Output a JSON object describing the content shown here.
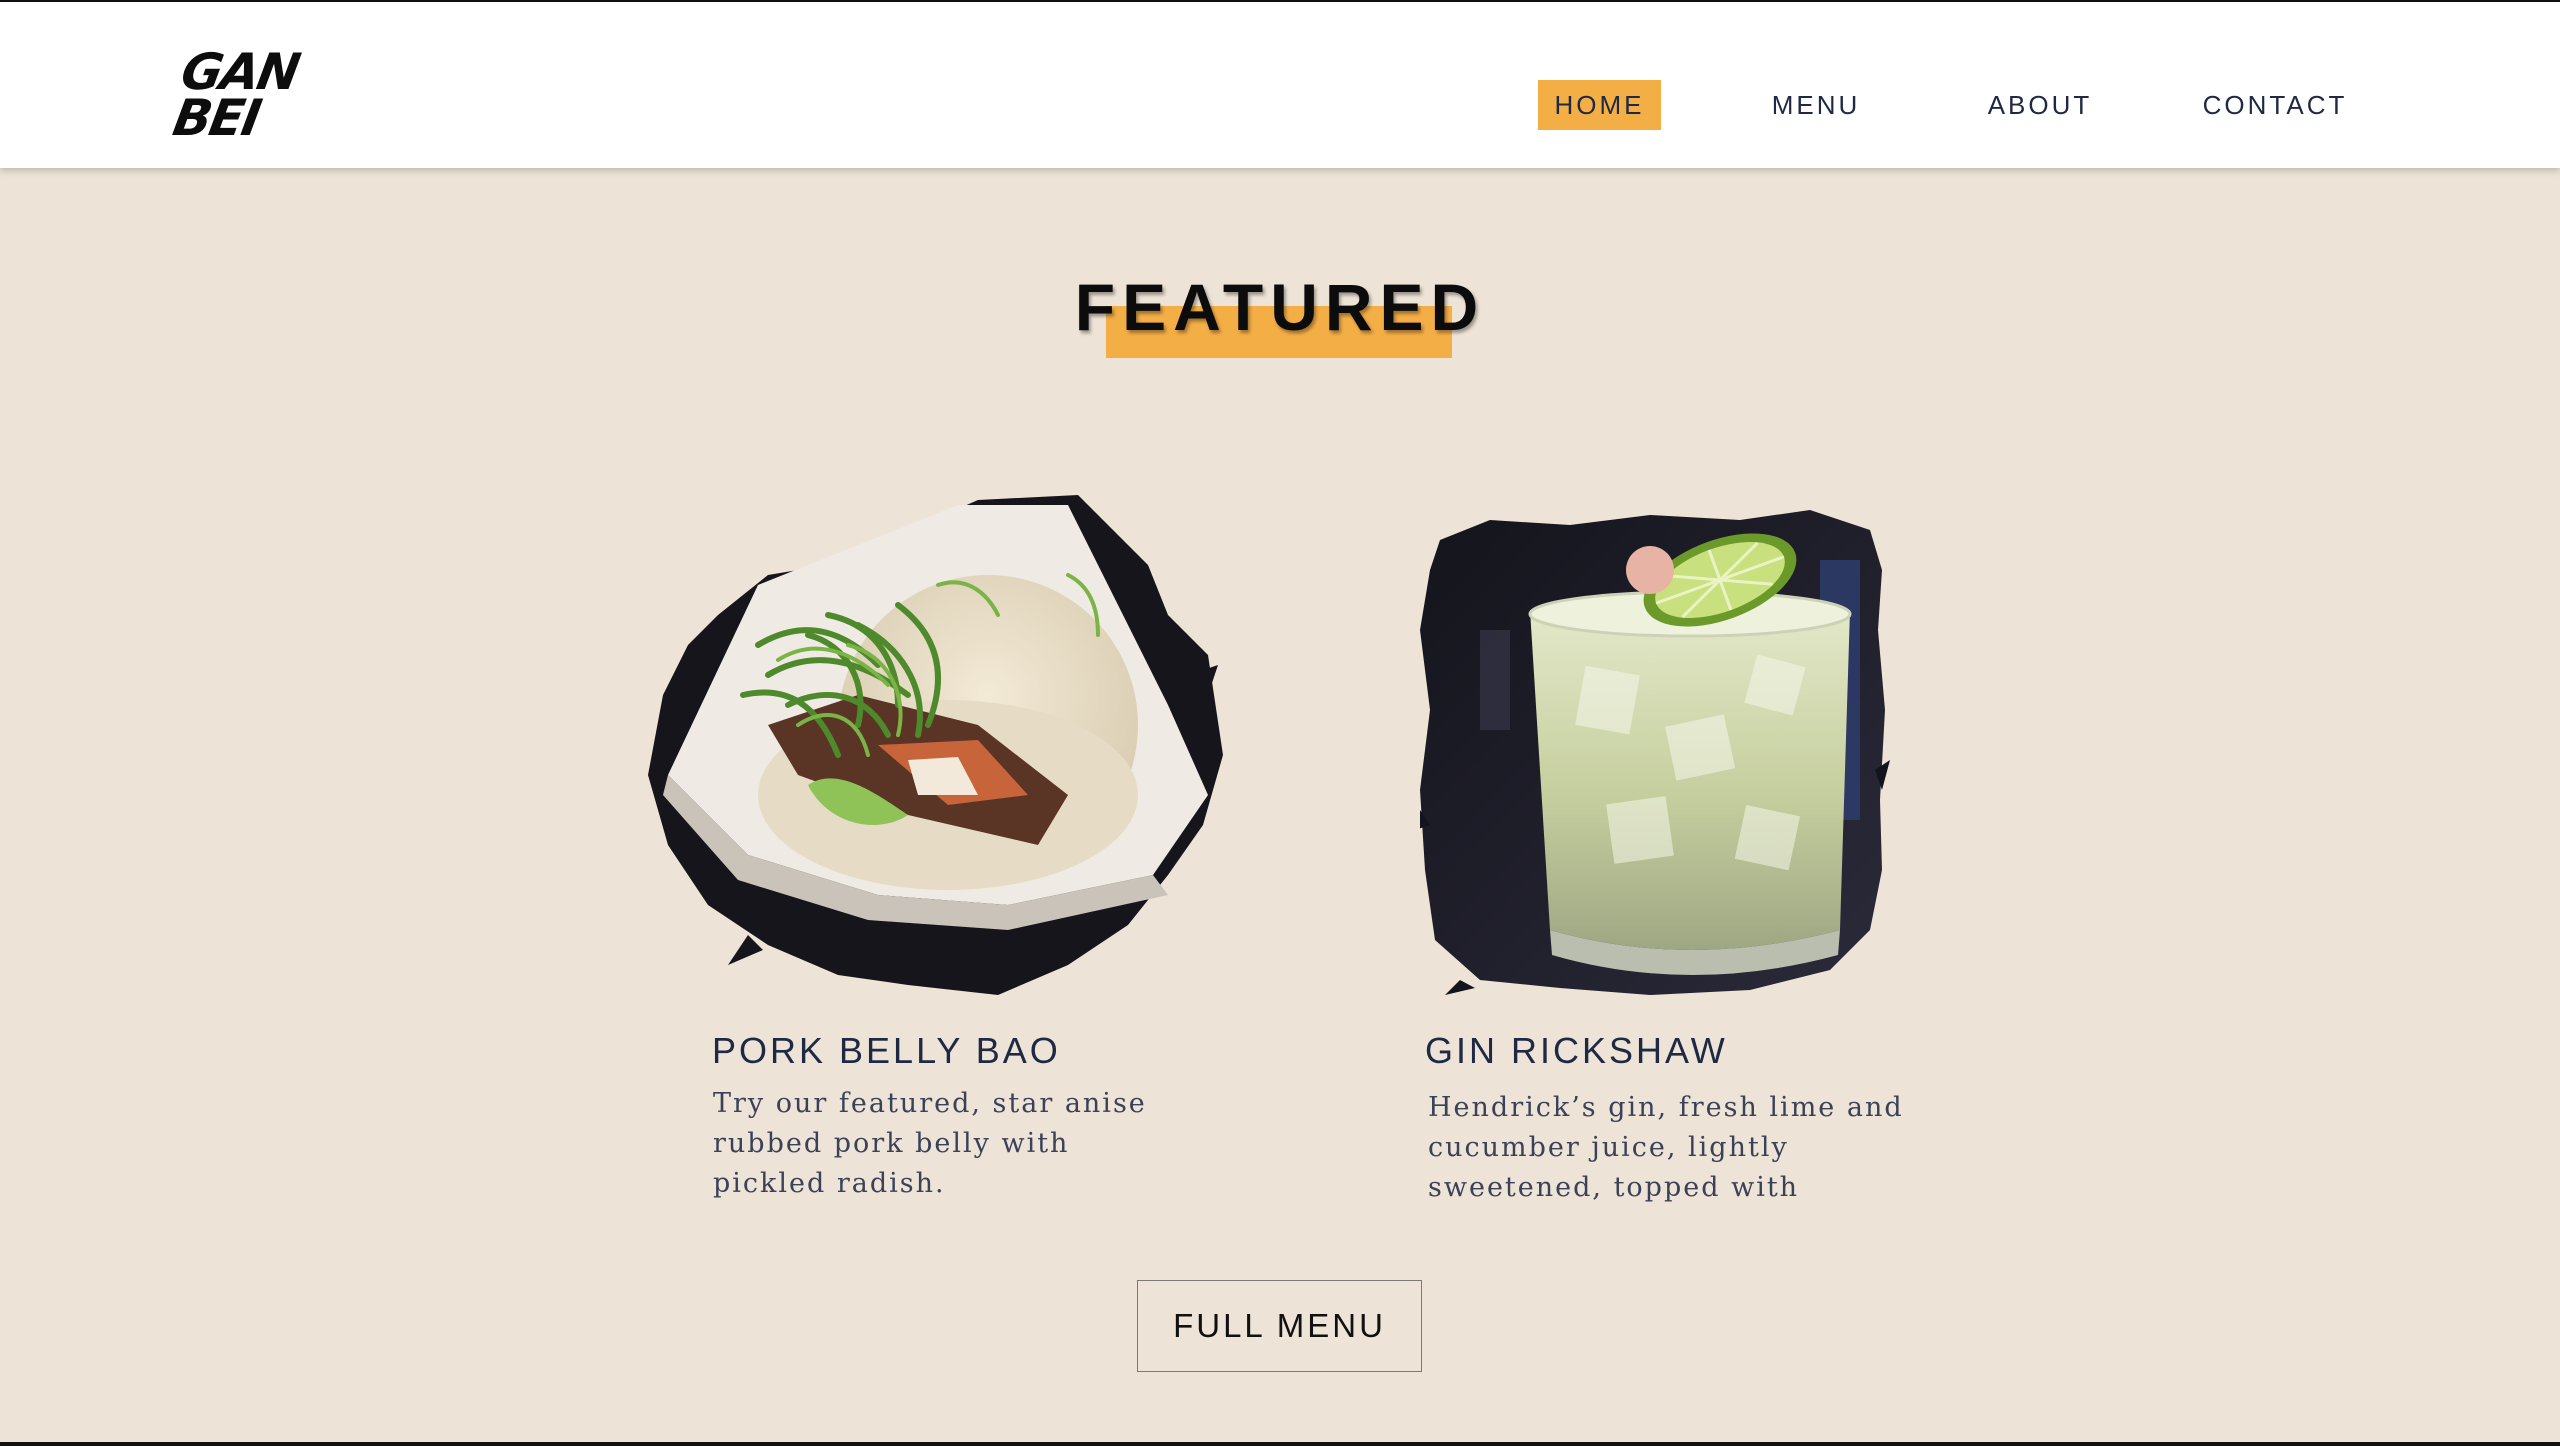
{
  "brand": {
    "logo_text": "GAN BEI",
    "logo_line1": "GAN",
    "logo_line2": "BEI"
  },
  "nav": {
    "items": [
      {
        "label": "HOME",
        "active": true
      },
      {
        "label": "MENU",
        "active": false
      },
      {
        "label": "ABOUT",
        "active": false
      },
      {
        "label": "CONTACT",
        "active": false
      }
    ]
  },
  "featured": {
    "title": "FEATURED",
    "items": [
      {
        "name": "PORK BELLY BAO",
        "description": "Try our featured, star anise rubbed pork belly  with pickled radish.",
        "image_icon": "pork-belly-bao-photo"
      },
      {
        "name": "GIN RICKSHAW",
        "description": "Hendrick’s gin, fresh lime and cucumber juice, lightly sweetened, topped with",
        "image_icon": "gin-rickshaw-photo"
      }
    ],
    "cta_label": "FULL MENU"
  },
  "colors": {
    "accent": "#F4AE46",
    "background": "#EDE3D6",
    "nav_text": "#1F2944",
    "header_bg": "#FFFFFF"
  }
}
